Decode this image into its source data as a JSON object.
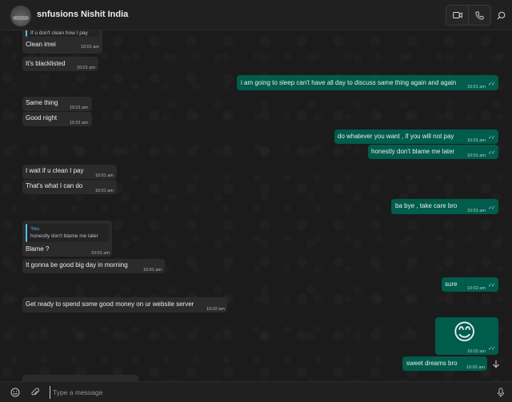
{
  "header": {
    "contact_name": "snfusions Nishit India",
    "avatar_icon": "contact-avatar",
    "video_call_icon": "video-call-icon",
    "voice_call_icon": "phone-icon",
    "search_icon": "search-icon"
  },
  "messages": [
    {
      "dir": "in",
      "quote": {
        "text": "If u don't clean how I pay"
      },
      "text": "Clean imei",
      "time": "10:01 am"
    },
    {
      "dir": "in",
      "text": "It's blacklisted",
      "time": "10:01 am"
    },
    {
      "dir": "out",
      "text": "i am going to sleep can't have all day to discuss same thing again and again",
      "time": "10:01 am"
    },
    {
      "dir": "in",
      "text": "Same thing",
      "time": "10:01 am"
    },
    {
      "dir": "in",
      "text": "Good night",
      "time": "10:01 am"
    },
    {
      "dir": "out",
      "text": "do whatever you want , if you will not pay",
      "time": "10:01 am"
    },
    {
      "dir": "out",
      "text": "honestly don't blame me later",
      "time": "10:01 am"
    },
    {
      "dir": "in",
      "text": "I wait if u clean I pay",
      "time": "10:01 am"
    },
    {
      "dir": "in",
      "text": "That's what I can do",
      "time": "10:01 am"
    },
    {
      "dir": "out",
      "text": "ba bye , take care bro",
      "time": "10:01 am"
    },
    {
      "dir": "in",
      "quote": {
        "author": "You",
        "text": "honestly don't blame me later"
      },
      "text": "Blame ?",
      "time": "10:01 am"
    },
    {
      "dir": "in",
      "text": "It gonna be good big day in morning",
      "time": "10:01 am"
    },
    {
      "dir": "out",
      "text": "sure",
      "time": "10:02 am"
    },
    {
      "dir": "in",
      "text": "Get ready to spend some good money on ur website server",
      "time": "10:02 am"
    },
    {
      "dir": "out",
      "emoji": "😊",
      "text": "",
      "time": "10:02 am"
    },
    {
      "dir": "out",
      "text": "sweet dreams bro",
      "time": "10:02 am"
    }
  ],
  "composer": {
    "placeholder": "Type a message",
    "emoji_icon": "emoji-icon",
    "attach_icon": "paperclip-icon",
    "mic_icon": "microphone-icon"
  },
  "scroll_down_icon": "arrow-down-icon",
  "colors": {
    "incoming_bubble": "#2b2b2b",
    "outgoing_bubble": "#005c4b",
    "read_ticks": "#7fd0ff",
    "quote_accent": "#53bdeb"
  }
}
